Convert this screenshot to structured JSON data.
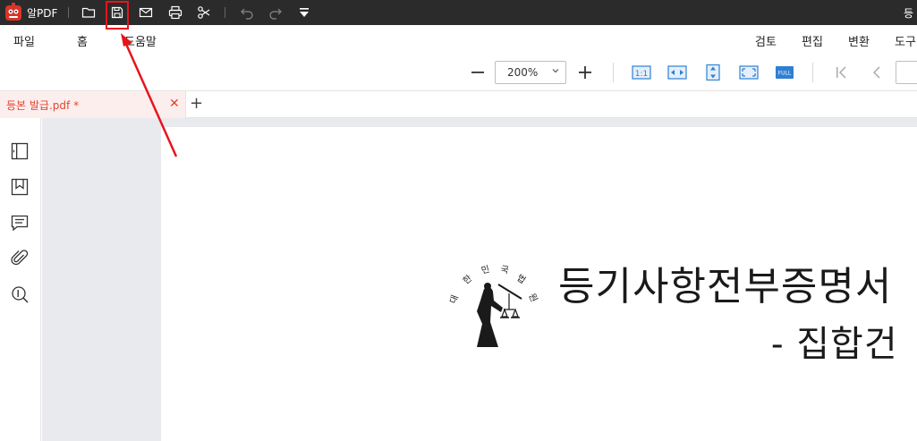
{
  "titlebar": {
    "app_name": "알PDF",
    "doc_title": "등",
    "icons": [
      "logo-icon",
      "folder-icon",
      "save-icon",
      "mail-icon",
      "print-icon",
      "scissors-icon",
      "undo-icon",
      "redo-icon",
      "dropdown-icon"
    ]
  },
  "menu": {
    "items": [
      "파일",
      "홈",
      "도움말",
      "검토",
      "편집",
      "변환",
      "도구"
    ]
  },
  "toolbar": {
    "zoom_value": "200%",
    "fit_actual_label": "1:1",
    "full_label": "FULL"
  },
  "tabs": [
    {
      "label": "등본 발급.pdf *",
      "close": "✕"
    }
  ],
  "tab_add": "+",
  "document": {
    "heading": "등기사항전부증명서",
    "subheading": "- 집합건",
    "seal_text": "대한민국법원"
  },
  "colors": {
    "titlebar_bg": "#2b2b2b",
    "tab_active_bg": "#fdeeee",
    "tab_active_text": "#e0452f",
    "annotation_red": "#e8141c",
    "accent_blue": "#2f7fd1"
  }
}
